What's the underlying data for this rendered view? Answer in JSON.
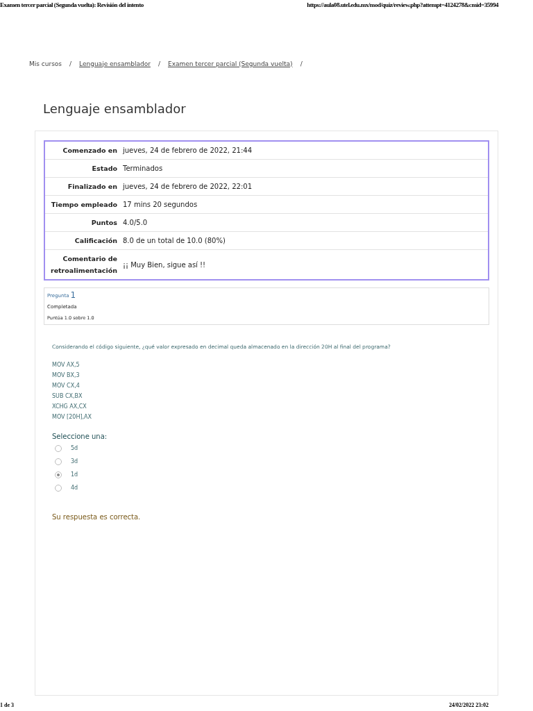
{
  "print_header": {
    "title": "Examen tercer parcial (Segunda vuelta): Revisión del intento",
    "url": "https://aula08.utel.edu.mx/mod/quiz/review.php?attempt=4124278&cmid=35994"
  },
  "breadcrumb": [
    {
      "label": "Mis cursos",
      "link": false,
      "separator": "/"
    },
    {
      "label": "Lenguaje ensamblador",
      "link": true,
      "separator": "/"
    },
    {
      "label": "Examen tercer parcial (Segunda vuelta)",
      "link": true,
      "separator": "/"
    }
  ],
  "page_title": "Lenguaje ensamblador",
  "summary": [
    {
      "label": "Comenzado en",
      "value": "jueves, 24 de febrero de 2022, 21:44"
    },
    {
      "label": "Estado",
      "value": "Terminados"
    },
    {
      "label": "Finalizado en",
      "value": "jueves, 24 de febrero de 2022, 22:01"
    },
    {
      "label": "Tiempo empleado",
      "value": "17 mins 20 segundos"
    },
    {
      "label": "Puntos",
      "value": "4.0/5.0"
    },
    {
      "label": "Calificación",
      "value": "8.0 de un total de 10.0 (80%)"
    },
    {
      "label": "Comentario de retroalimentación",
      "value": "¡¡ Muy Bien, sigue así !!"
    }
  ],
  "question_info": {
    "label": "Pregunta",
    "number": "1",
    "state": "Completada",
    "grade": "Puntúa 1.0 sobre 1.0"
  },
  "question": {
    "text": "Considerando el código siguiente, ¿qué valor expresado en decimal queda almacenado en la dirección 20H al final del programa?",
    "code": [
      "MOV AX,5",
      "MOV BX,3",
      "MOV CX,4",
      "SUB CX,BX",
      "XCHG AX,CX",
      "MOV [20H],AX"
    ],
    "prompt": "Seleccione una:",
    "options": [
      {
        "label": "5d",
        "selected": false
      },
      {
        "label": "3d",
        "selected": false
      },
      {
        "label": "1d",
        "selected": true
      },
      {
        "label": "4d",
        "selected": false
      }
    ],
    "feedback": "Su respuesta es correcta."
  },
  "print_footer": {
    "page": "1 de 3",
    "datetime": "24/02/2022 23:02"
  }
}
